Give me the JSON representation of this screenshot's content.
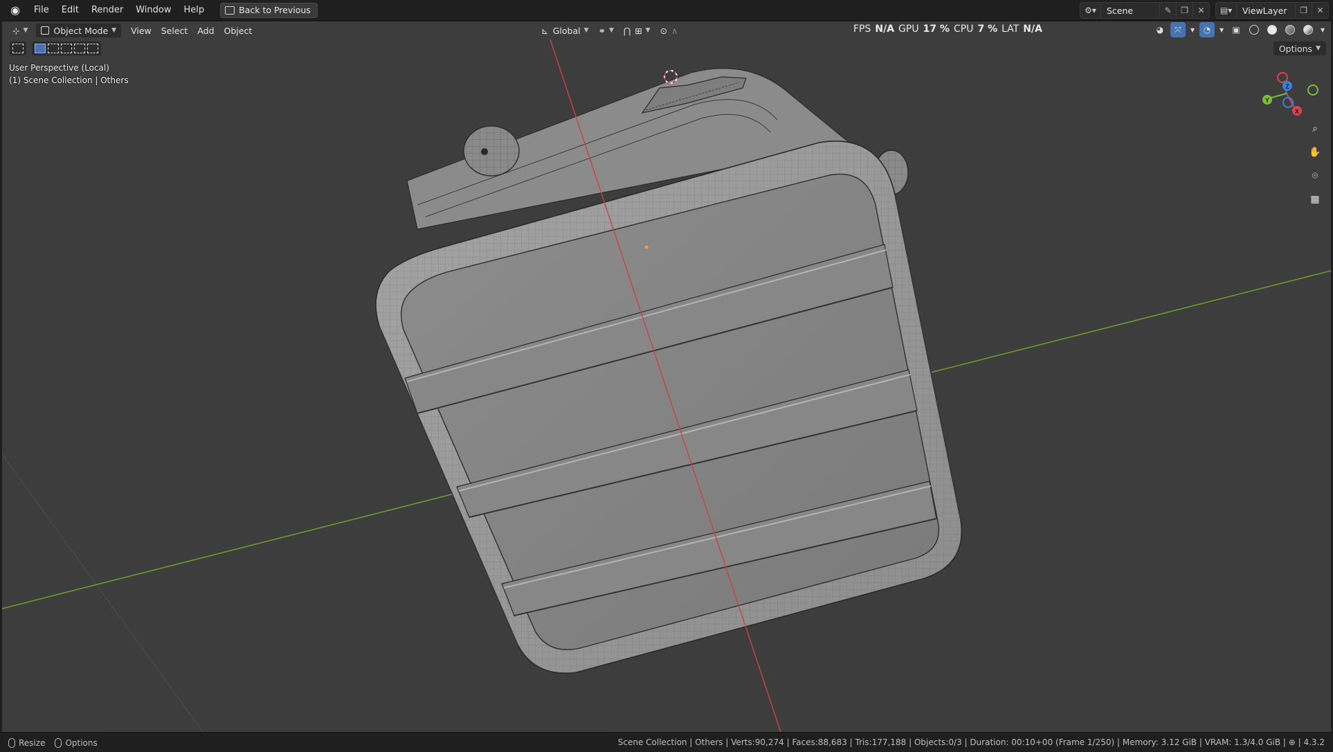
{
  "menubar": {
    "logo_icon": "blender-logo-icon",
    "items": [
      {
        "label": "File"
      },
      {
        "label": "Edit"
      },
      {
        "label": "Render"
      },
      {
        "label": "Window"
      },
      {
        "label": "Help"
      }
    ],
    "back_button": "Back to Previous",
    "scene_name": "Scene",
    "view_layer": "ViewLayer"
  },
  "viewport_header": {
    "mode": "Object Mode",
    "menus": [
      {
        "label": "View"
      },
      {
        "label": "Select"
      },
      {
        "label": "Add"
      },
      {
        "label": "Object"
      }
    ],
    "transform_orientation": "Global",
    "options_label": "Options"
  },
  "stats_overlay": {
    "fps_label": "FPS",
    "fps_value": "N/A",
    "gpu_label": "GPU",
    "gpu_value": "17 %",
    "cpu_label": "CPU",
    "cpu_value": "7 %",
    "lat_label": "LAT",
    "lat_value": "N/A"
  },
  "viewport_info": {
    "line1": "User Perspective (Local)",
    "line2": "(1) Scene Collection | Others"
  },
  "gizmo": {
    "axes": [
      {
        "label": "Z",
        "color": "#3f7fdb"
      },
      {
        "label": "Y",
        "color": "#7cbc3a"
      },
      {
        "label": "X",
        "color": "#d9434d"
      }
    ]
  },
  "statusbar": {
    "left": [
      {
        "label": "Resize"
      },
      {
        "label": "Options"
      }
    ],
    "right": "Scene Collection | Others | Verts:90,274 | Faces:88,683 | Tris:177,188 | Objects:0/3 | Duration: 00:10+00 (Frame 1/250) | Memory: 3.12 GiB | VRAM: 1.3/4.0 GiB | ⊕ | 4.3.2"
  },
  "colors": {
    "viewport_bg": "#3d3d3d",
    "x_axis": "#c94444",
    "y_axis": "#6e9a2c",
    "accent": "#4772b3"
  }
}
